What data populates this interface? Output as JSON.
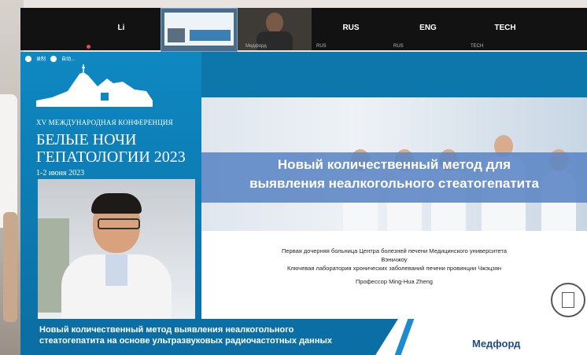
{
  "participants": [
    {
      "name": "Li",
      "sub": ""
    },
    {
      "name": "",
      "sub": ""
    },
    {
      "name": "",
      "sub": "Медфорд"
    },
    {
      "name": "RUS",
      "sub": "RUS"
    },
    {
      "name": "ENG",
      "sub": "RUS"
    },
    {
      "name": "TECH",
      "sub": "TECH"
    }
  ],
  "toolbar": {
    "icons": [
      "record-icon",
      "status-icon"
    ],
    "labels": [
      "录制",
      "自动..."
    ]
  },
  "conference": {
    "small": "XV МЕЖДУНАРОДНАЯ КОНФЕРЕНЦИЯ",
    "title_line1": "БЕЛЫЕ НОЧИ",
    "title_line2": "ГЕПАТОЛОГИИ 2023",
    "date": "1-2 июня 2023"
  },
  "slide": {
    "title_line1": "Новый количественный метод для",
    "title_line2": "выявления неалкогольного стеатогепатита",
    "aff1": "Первая дочерняя больница Центра болезней печени Медицинского университета",
    "aff2": "Вэньчжоу",
    "aff3": "Ключевая лаборатория хронических заболеваний печени провинции Чжэцзян",
    "professor": "Профессор Ming-Hua Zheng"
  },
  "bottom": {
    "line1": "Новый количественный метод выявления неалкогольного",
    "line2": "стеатогепатита на основе ультразвуковых радиочастотных данных",
    "brand": "Медфорд"
  },
  "colors": {
    "accent": "#0b6fa5",
    "band": "#5b85c5",
    "brand": "#1f4d80"
  }
}
